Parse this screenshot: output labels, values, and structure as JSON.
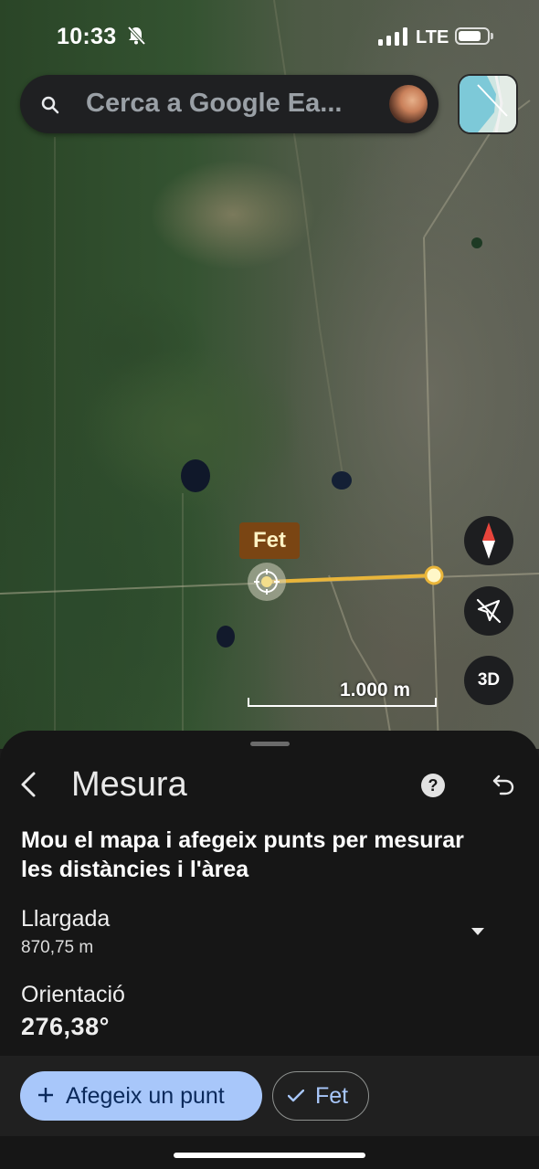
{
  "status_bar": {
    "time": "10:33",
    "network": "LTE"
  },
  "search": {
    "placeholder": "Cerca a Google Ea..."
  },
  "map": {
    "done_tag": "Fet",
    "scale_label": "1.000 m",
    "three_d_label": "3D",
    "colors": {
      "measure_line": "#e9b53a",
      "done_tag_bg": "#7a4513"
    }
  },
  "sheet": {
    "title": "Mesura",
    "instructions": "Mou el mapa i afegeix punts per mesurar les distàncies i l'àrea",
    "length_label": "Llargada",
    "length_value": "870,75 m",
    "orientation_label": "Orientació",
    "orientation_value": "276,38°"
  },
  "actions": {
    "add_point": "Afegeix un punt",
    "done": "Fet",
    "accent": "#a8c7fa"
  },
  "icons": [
    "search-icon",
    "bell-off-icon",
    "signal-icon",
    "battery-icon",
    "layers-thumbnail",
    "compass-icon",
    "location-off-icon",
    "back-icon",
    "help-icon",
    "undo-icon",
    "chevron-down-icon",
    "plus-icon",
    "check-icon"
  ]
}
